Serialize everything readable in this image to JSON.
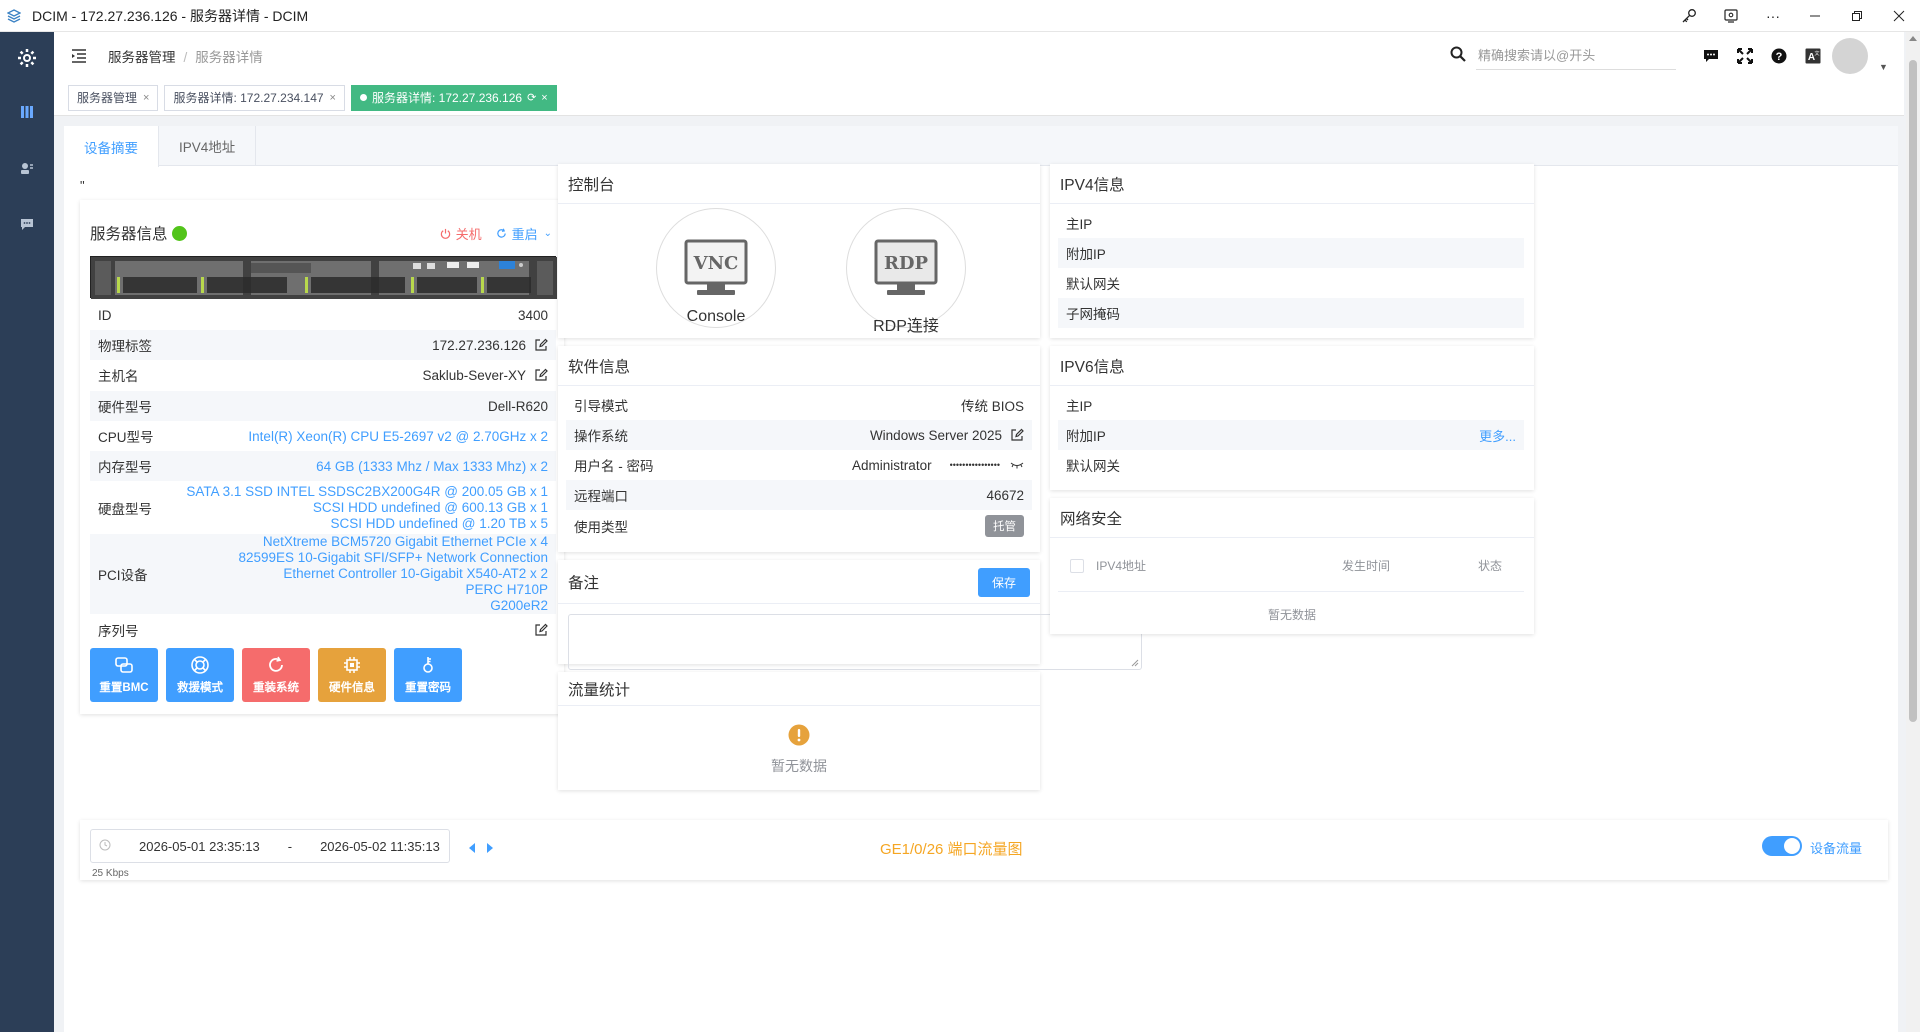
{
  "window": {
    "title": "DCIM - 172.27.236.126 - 服务器详情 - DCIM"
  },
  "header": {
    "breadcrumb": [
      "服务器管理",
      "服务器详情"
    ],
    "search_placeholder": "精确搜索请以@开头"
  },
  "tags": [
    {
      "label": "服务器管理"
    },
    {
      "label": "服务器详情: 172.27.234.147"
    },
    {
      "label": "服务器详情: 172.27.236.126",
      "active": true
    }
  ],
  "page_tabs": [
    "设备摘要",
    "IPV4地址"
  ],
  "stray_text": "\"",
  "server_info": {
    "title": "服务器信息",
    "status_color": "#52c41a",
    "shutdown_label": "关机",
    "reboot_label": "重启",
    "rows": {
      "id_label": "ID",
      "id_value": "3400",
      "tag_label": "物理标签",
      "tag_value": "172.27.236.126",
      "host_label": "主机名",
      "host_value": "Saklub-Sever-XY",
      "hw_label": "硬件型号",
      "hw_value": "Dell-R620",
      "cpu_label": "CPU型号",
      "cpu_value": "Intel(R) Xeon(R) CPU E5-2697 v2 @ 2.70GHz x 2",
      "mem_label": "内存型号",
      "mem_value": "64 GB (1333 Mhz / Max 1333 Mhz) x 2",
      "disk_label": "硬盘型号",
      "disk_values": [
        "SATA 3.1 SSD INTEL SSDSC2BX200G4R @ 200.05 GB x 1",
        "SCSI HDD undefined @ 600.13 GB x 1",
        "SCSI HDD undefined @ 1.20 TB x 5"
      ],
      "pci_label": "PCI设备",
      "pci_values": [
        "NetXtreme BCM5720 Gigabit Ethernet PCIe x 4",
        "82599ES 10-Gigabit SFI/SFP+ Network Connection",
        "Ethernet Controller 10-Gigabit X540-AT2 x 2",
        "PERC H710P",
        "G200eR2"
      ],
      "serial_label": "序列号"
    },
    "buttons": [
      {
        "label": "重置BMC",
        "color": "#409eff"
      },
      {
        "label": "救援模式",
        "color": "#409eff"
      },
      {
        "label": "重装系统",
        "color": "#f56c6c"
      },
      {
        "label": "硬件信息",
        "color": "#e6a23c"
      },
      {
        "label": "重置密码",
        "color": "#409eff"
      }
    ]
  },
  "console": {
    "title": "控制台",
    "vnc_text": "VNC",
    "vnc_label": "Console",
    "rdp_text": "RDP",
    "rdp_label": "RDP连接"
  },
  "software": {
    "title": "软件信息",
    "boot_label": "引导模式",
    "boot_value": "传统 BIOS",
    "os_label": "操作系统",
    "os_value": "Windows Server 2025",
    "user_label": "用户名 - 密码",
    "user_value": "Administrator",
    "password_value": "••••••••••••••••",
    "port_label": "远程端口",
    "port_value": "46672",
    "use_label": "使用类型",
    "use_value": "托管"
  },
  "remarks": {
    "title": "备注",
    "save_label": "保存"
  },
  "traffic": {
    "title": "流量统计",
    "empty_text": "暂无数据"
  },
  "ipv4": {
    "title": "IPV4信息",
    "rows": [
      "主IP",
      "附加IP",
      "默认网关",
      "子网掩码"
    ]
  },
  "ipv6": {
    "title": "IPV6信息",
    "rows": [
      "主IP",
      "附加IP",
      "默认网关"
    ],
    "more_label": "更多..."
  },
  "security": {
    "title": "网络安全",
    "columns": [
      "IPV4地址",
      "发生时间",
      "状态"
    ],
    "empty_text": "暂无数据"
  },
  "bottom": {
    "start": "2026-05-01 23:35:13",
    "dash": "-",
    "end": "2026-05-02 11:35:13",
    "chart_title": "GE1/0/26 端口流量图",
    "toggle_label": "设备流量",
    "axis_fragment": "25 Kbps"
  }
}
